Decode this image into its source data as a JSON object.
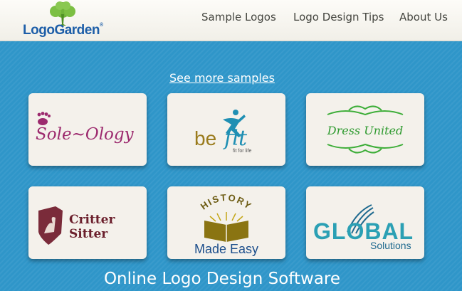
{
  "header": {
    "logo_part1": "Logo",
    "logo_part2": "Garden",
    "logo_tm": "®",
    "nav": [
      {
        "label": "Sample Logos"
      },
      {
        "label": "Logo Design Tips"
      },
      {
        "label": "About Us"
      }
    ]
  },
  "main": {
    "see_more": "See more samples",
    "footer_title": "Online Logo Design Software"
  },
  "samples": [
    {
      "text": "Sole~Ology"
    },
    {
      "text1": "be",
      "text2": "fit",
      "tagline": "fit for life"
    },
    {
      "text": "Dress United"
    },
    {
      "text1": "Critter",
      "text2": "Sitter"
    },
    {
      "arc": "HISTORY",
      "text": "Made Easy"
    },
    {
      "text": "GLOBAL",
      "sub": "Solutions"
    }
  ],
  "colors": {
    "background": "#2f96c9",
    "header_bg": "#f6f4ee",
    "logo_blue": "#1d5ea8",
    "logo_green": "#5aa02c"
  }
}
